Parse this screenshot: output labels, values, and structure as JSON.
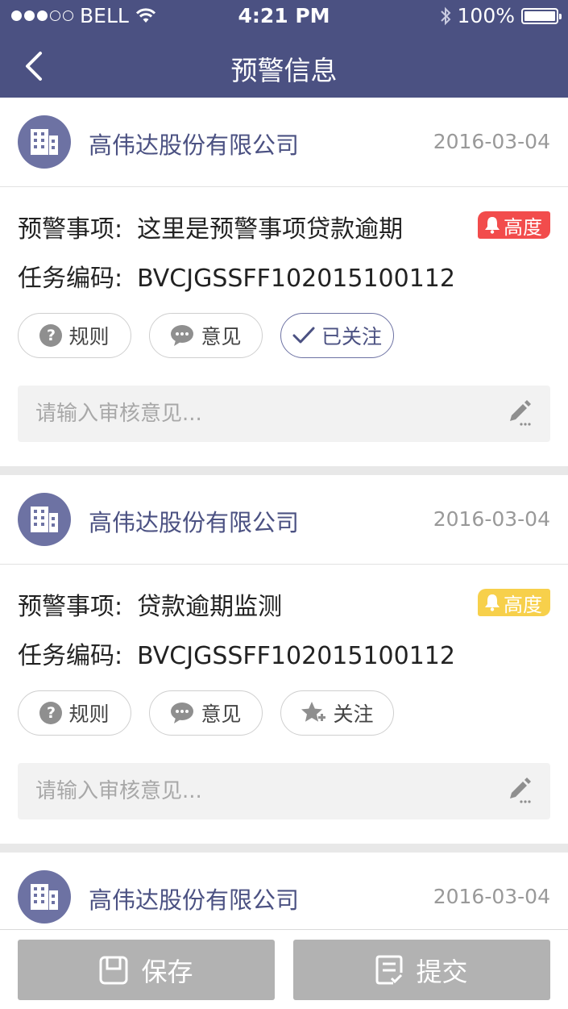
{
  "status_bar": {
    "carrier": "BELL",
    "time": "4:21 PM",
    "battery": "100%"
  },
  "nav": {
    "title": "预警信息"
  },
  "cards": [
    {
      "company": "高伟达股份有限公司",
      "date": "2016-03-04",
      "warning_label": "预警事项:",
      "warning_value": "这里是预警事项贷款逾期",
      "task_label": "任务编码:",
      "task_value": "BVCJGSSFF102015100112",
      "level": "高度",
      "level_color": "#f24c4c",
      "rule_label": "规则",
      "opinion_label": "意见",
      "follow_label": "已关注",
      "followed": true,
      "comment_placeholder": "请输入审核意见..."
    },
    {
      "company": "高伟达股份有限公司",
      "date": "2016-03-04",
      "warning_label": "预警事项:",
      "warning_value": "贷款逾期监测",
      "task_label": "任务编码:",
      "task_value": "BVCJGSSFF102015100112",
      "level": "高度",
      "level_color": "#f7d04b",
      "rule_label": "规则",
      "opinion_label": "意见",
      "follow_label": "关注",
      "followed": false,
      "comment_placeholder": "请输入审核意见..."
    },
    {
      "company": "高伟达股份有限公司",
      "date": "2016-03-04"
    }
  ],
  "bottom": {
    "save_label": "保存",
    "submit_label": "提交"
  },
  "colors": {
    "primary": "#4b5182",
    "avatar": "#6d72a3",
    "button_disabled": "#b2b2b2"
  }
}
